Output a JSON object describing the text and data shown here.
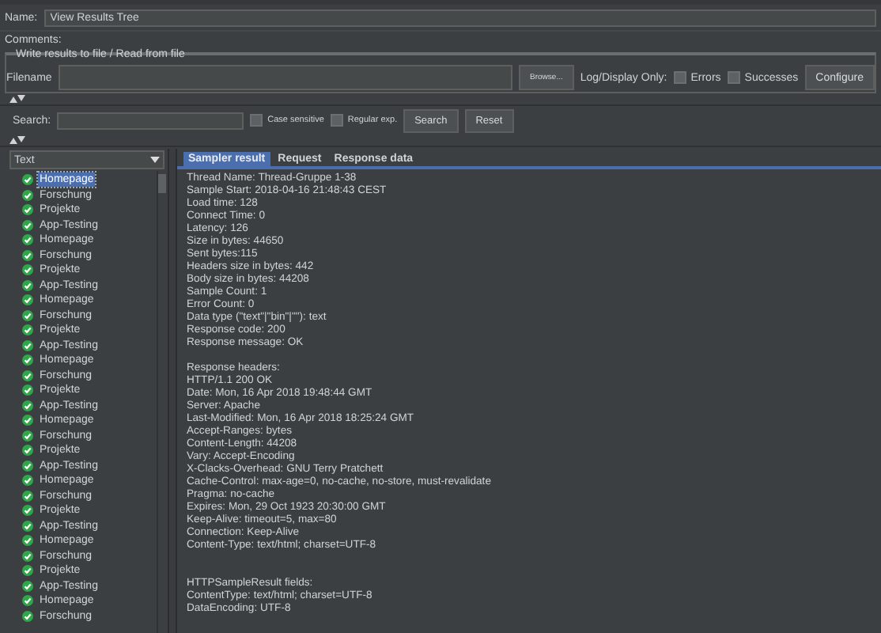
{
  "name_field": {
    "label": "Name:",
    "value": "View Results Tree"
  },
  "comments": {
    "label": "Comments:"
  },
  "file_group": {
    "title": "Write results to file / Read from file",
    "filename_label": "Filename",
    "browse_button": "Browse...",
    "log_label": "Log/Display Only:",
    "options": [
      {
        "label": "Errors",
        "checked": false
      },
      {
        "label": "Successes",
        "checked": false
      }
    ],
    "configure_button": "Configure"
  },
  "search": {
    "label": "Search:",
    "options": [
      {
        "label": "Case sensitive",
        "checked": false
      },
      {
        "label": "Regular exp.",
        "checked": false
      }
    ],
    "search_button": "Search",
    "reset_button": "Reset"
  },
  "renderer": {
    "value": "Text"
  },
  "tree": [
    {
      "label": "Homepage",
      "selected": true
    },
    {
      "label": "Forschung",
      "selected": false
    },
    {
      "label": "Projekte",
      "selected": false
    },
    {
      "label": "App-Testing",
      "selected": false
    },
    {
      "label": "Homepage",
      "selected": false
    },
    {
      "label": "Forschung",
      "selected": false
    },
    {
      "label": "Projekte",
      "selected": false
    },
    {
      "label": "App-Testing",
      "selected": false
    },
    {
      "label": "Homepage",
      "selected": false
    },
    {
      "label": "Forschung",
      "selected": false
    },
    {
      "label": "Projekte",
      "selected": false
    },
    {
      "label": "App-Testing",
      "selected": false
    },
    {
      "label": "Homepage",
      "selected": false
    },
    {
      "label": "Forschung",
      "selected": false
    },
    {
      "label": "Projekte",
      "selected": false
    },
    {
      "label": "App-Testing",
      "selected": false
    },
    {
      "label": "Homepage",
      "selected": false
    },
    {
      "label": "Forschung",
      "selected": false
    },
    {
      "label": "Projekte",
      "selected": false
    },
    {
      "label": "App-Testing",
      "selected": false
    },
    {
      "label": "Homepage",
      "selected": false
    },
    {
      "label": "Forschung",
      "selected": false
    },
    {
      "label": "Projekte",
      "selected": false
    },
    {
      "label": "App-Testing",
      "selected": false
    },
    {
      "label": "Homepage",
      "selected": false
    },
    {
      "label": "Forschung",
      "selected": false
    },
    {
      "label": "Projekte",
      "selected": false
    },
    {
      "label": "App-Testing",
      "selected": false
    },
    {
      "label": "Homepage",
      "selected": false
    },
    {
      "label": "Forschung",
      "selected": false
    }
  ],
  "tabs": [
    {
      "label": "Sampler result",
      "selected": true
    },
    {
      "label": "Request",
      "selected": false
    },
    {
      "label": "Response data",
      "selected": false
    }
  ],
  "result_sections": [
    [
      "Thread Name: Thread-Gruppe 1-38",
      "Sample Start: 2018-04-16 21:48:43 CEST",
      "Load time: 128",
      "Connect Time: 0",
      "Latency: 126",
      "Size in bytes: 44650",
      "Sent bytes:115",
      "Headers size in bytes: 442",
      "Body size in bytes: 44208",
      "Sample Count: 1",
      "Error Count: 0",
      "Data type (\"text\"|\"bin\"|\"\"): text",
      "Response code: 200",
      "Response message: OK"
    ],
    [
      "Response headers:",
      "HTTP/1.1 200 OK",
      "Date: Mon, 16 Apr 2018 19:48:44 GMT",
      "Server: Apache",
      "Last-Modified: Mon, 16 Apr 2018 18:25:24 GMT",
      "Accept-Ranges: bytes",
      "Content-Length: 44208",
      "Vary: Accept-Encoding",
      "X-Clacks-Overhead: GNU Terry Pratchett",
      "Cache-Control: max-age=0, no-cache, no-store, must-revalidate",
      "Pragma: no-cache",
      "Expires: Mon, 29 Oct 1923 20:30:00 GMT",
      "Keep-Alive: timeout=5, max=80",
      "Connection: Keep-Alive",
      "Content-Type: text/html; charset=UTF-8"
    ],
    [
      "HTTPSampleResult fields:",
      "ContentType: text/html; charset=UTF-8",
      "DataEncoding: UTF-8"
    ]
  ]
}
